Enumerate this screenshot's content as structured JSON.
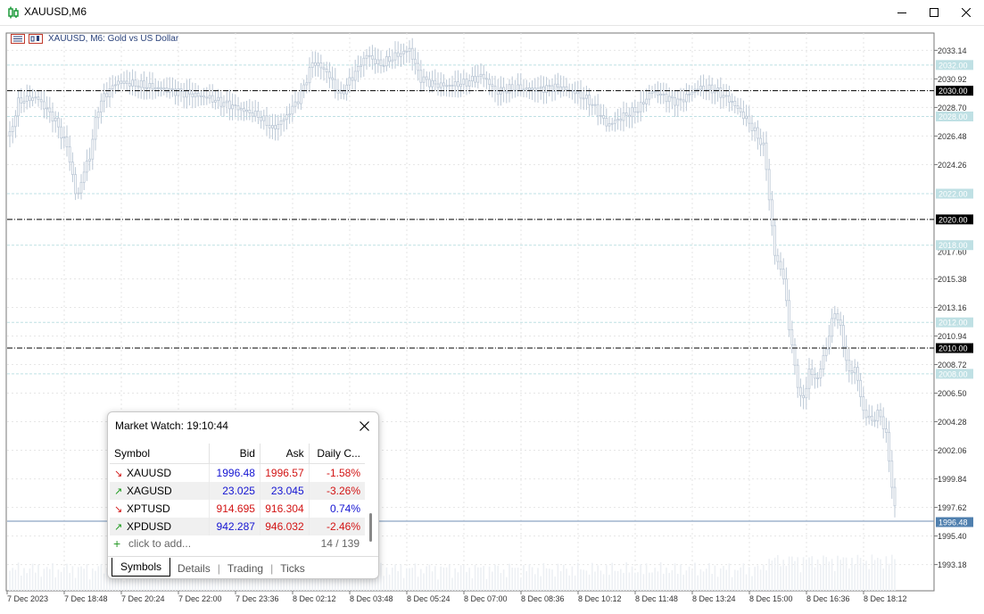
{
  "window": {
    "title": "XAUUSD,M6"
  },
  "chart": {
    "header": "XAUUSD, M6:  Gold vs US Dollar",
    "colors": {
      "candle": "#bcc8d6",
      "grid": "#e6e6e6",
      "level_line": "#bfe0e4",
      "axis_text": "#333333",
      "current_price_line": "#6f8fb5",
      "current_price_label_bg": "#4f7fae"
    },
    "price_ticks": [
      "2033.14",
      "2030.92",
      "2028.70",
      "2026.48",
      "2024.26",
      "2015.38",
      "2013.16",
      "2010.94",
      "2008.72",
      "2006.50",
      "2004.28",
      "2002.06",
      "1999.84",
      "1997.62",
      "1995.40",
      "1993.18"
    ],
    "level_labels": [
      "2032.00",
      "2028.00",
      "2022.00",
      "2018.00",
      "2012.00",
      "2008.00"
    ],
    "black_level_labels": [
      "2030.00",
      "2020.00",
      "2010.00"
    ],
    "current_price": "1996.48",
    "partial_tick": "2017.60",
    "time_ticks": [
      "7 Dec 2023",
      "7 Dec 18:48",
      "7 Dec 20:24",
      "7 Dec 22:00",
      "7 Dec 23:36",
      "8 Dec 02:12",
      "8 Dec 03:48",
      "8 Dec 05:24",
      "8 Dec 07:00",
      "8 Dec 08:36",
      "8 Dec 10:12",
      "8 Dec 11:48",
      "8 Dec 13:24",
      "8 Dec 15:00",
      "8 Dec 16:36",
      "8 Dec 18:12"
    ]
  },
  "market_watch": {
    "title": "Market Watch: 19:10:44",
    "columns": [
      "Symbol",
      "Bid",
      "Ask",
      "Daily C..."
    ],
    "rows": [
      {
        "dir": "down",
        "symbol": "XAUUSD",
        "bid": "1996.48",
        "ask": "1996.57",
        "change": "-1.58%"
      },
      {
        "dir": "up",
        "symbol": "XAGUSD",
        "bid": "23.025",
        "ask": "23.045",
        "change": "-3.26%"
      },
      {
        "dir": "down",
        "symbol": "XPTUSD",
        "bid": "914.695",
        "ask": "916.304",
        "change": "0.74%"
      },
      {
        "dir": "up",
        "symbol": "XPDUSD",
        "bid": "942.287",
        "ask": "946.032",
        "change": "-2.46%"
      }
    ],
    "add_text": "click to add...",
    "count": "14 / 139",
    "tabs": [
      "Symbols",
      "Details",
      "Trading",
      "Ticks"
    ]
  }
}
